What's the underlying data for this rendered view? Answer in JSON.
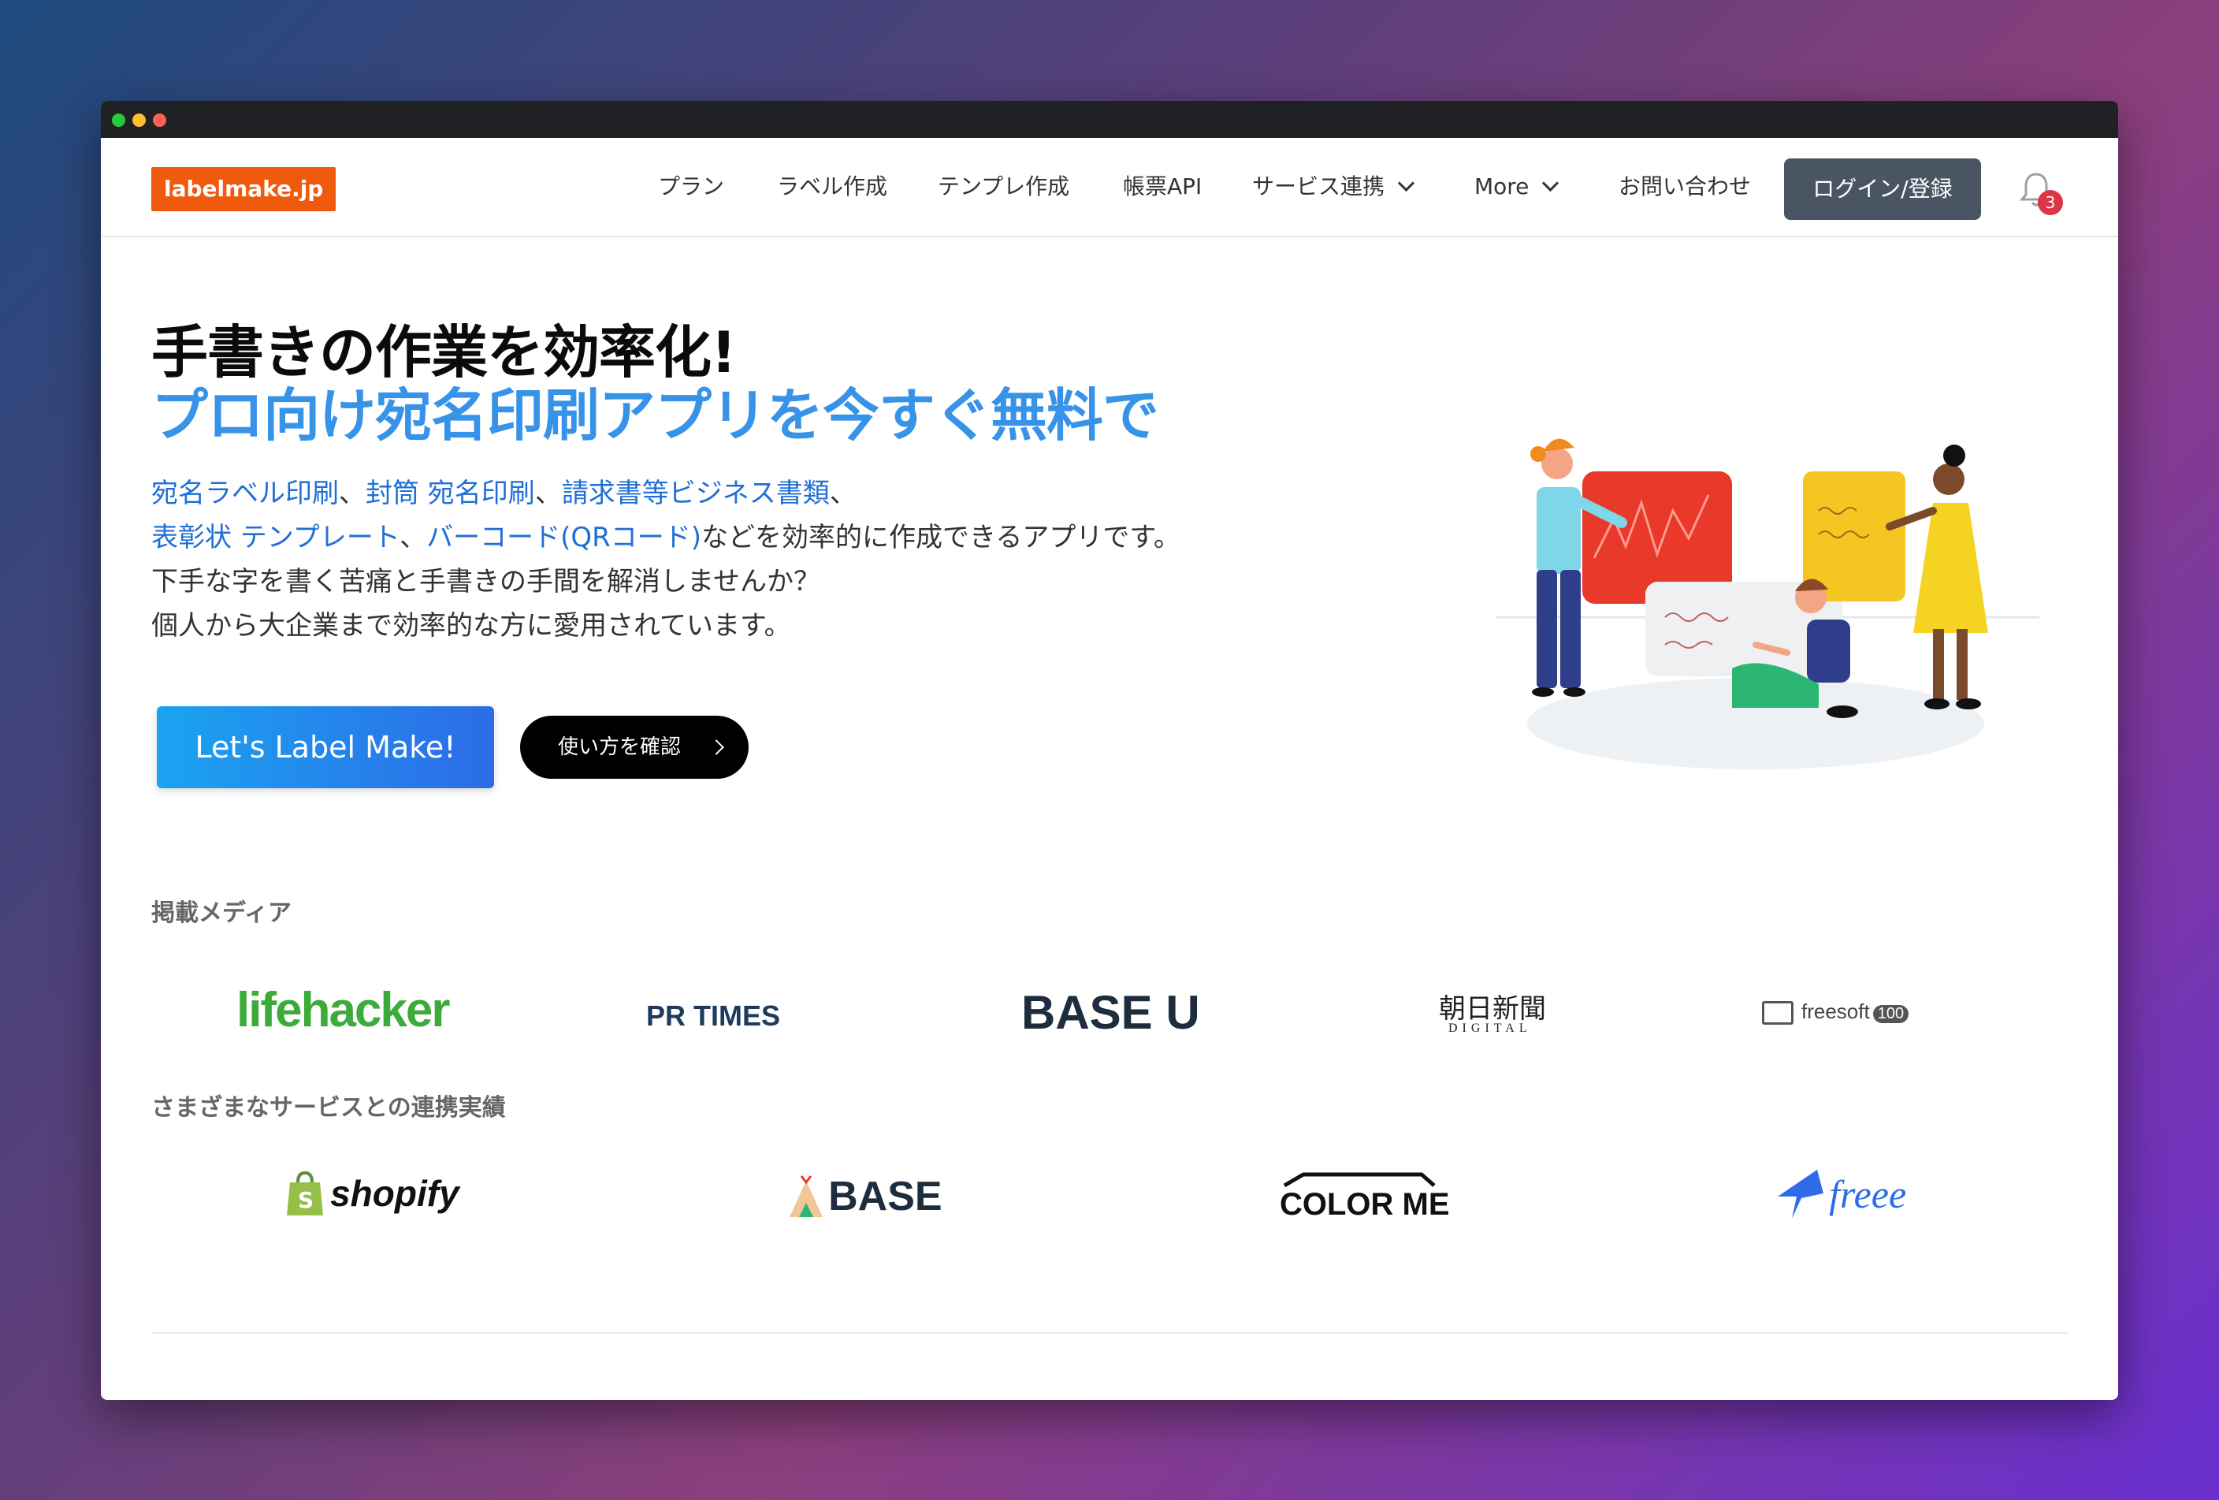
{
  "nav": {
    "logo": "labelmake.jp",
    "items": [
      "プラン",
      "ラベル作成",
      "テンプレ作成",
      "帳票API",
      "サービス連携",
      "More",
      "お問い合わせ"
    ],
    "login": "ログイン/登録",
    "notification_count": "3"
  },
  "hero": {
    "title_line1": "手書きの作業を効率化!",
    "title_line2": "プロ向け宛名印刷アプリを今すぐ無料で",
    "desc": {
      "l1_link1": "宛名ラベル印刷",
      "l1_sep1": "、",
      "l1_link2": "封筒 宛名印刷",
      "l1_sep2": "、",
      "l1_link3": "請求書等ビジネス書類",
      "l1_sep3": "、",
      "l2_link1": "表彰状 テンプレート",
      "l2_sep1": "、",
      "l2_link2": "バーコード(QRコード)",
      "l2_rest": "などを効率的に作成できるアプリです。",
      "l3": "下手な字を書く苦痛と手書きの手間を解消しませんか？",
      "l4": "個人から大企業まで効率的な方に愛用されています。"
    },
    "cta": "Let's Label Make!",
    "how_to": "使い方を確認"
  },
  "media": {
    "title": "掲載メディア",
    "logos": [
      "lifehacker",
      "PR TIMES",
      "BASE U",
      "朝日新聞",
      "DIGITAL",
      "freesoft",
      "100"
    ]
  },
  "integrations": {
    "title": "さまざまなサービスとの連携実績",
    "logos": [
      "shopify",
      "BASE",
      "COLOR ME",
      "freee"
    ]
  },
  "colors": {
    "accent_orange": "#f05a0f",
    "link_blue": "#1f6fd6",
    "headline_blue": "#3793e8"
  }
}
